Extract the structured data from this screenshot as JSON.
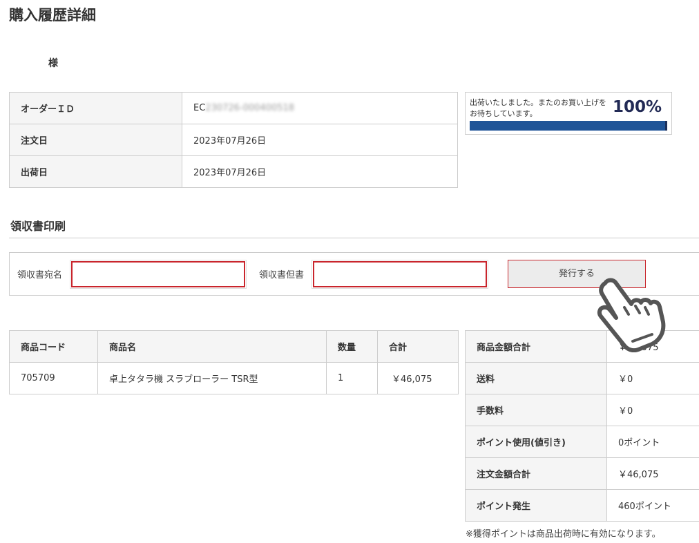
{
  "page_title": "購入履歴詳細",
  "customer_name": "様",
  "order": {
    "rows": [
      {
        "label": "オーダーＩＤ",
        "prefix": "EC",
        "value": "230726-000400518"
      },
      {
        "label": "注文日",
        "value": "2023年07月26日"
      },
      {
        "label": "出荷日",
        "value": "2023年07月26日"
      }
    ]
  },
  "status": {
    "message": "出荷いたしました。またのお買い上げをお待ちしています。",
    "percent_label": "100%",
    "progress": 1.0
  },
  "receipt": {
    "section_title": "領収書印刷",
    "addressee_label": "領収書宛名",
    "addressee_value": "",
    "proviso_label": "領収書但書",
    "proviso_value": "",
    "issue_button": "発行する"
  },
  "items": {
    "headers": [
      "商品コード",
      "商品名",
      "数量",
      "合計"
    ],
    "rows": [
      {
        "code": "705709",
        "name": "卓上タタラ機 スラブローラー TSR型",
        "qty": "1",
        "total": "￥46,075"
      }
    ]
  },
  "totals": [
    {
      "label": "商品金額合計",
      "value": "￥46,075"
    },
    {
      "label": "送料",
      "value": "￥0"
    },
    {
      "label": "手数料",
      "value": "￥0"
    },
    {
      "label": "ポイント使用(値引き)",
      "value": "0ポイント"
    },
    {
      "label": "注文金額合計",
      "value": "￥46,075"
    },
    {
      "label": "ポイント発生",
      "value": "460ポイント"
    }
  ],
  "points_note": "※獲得ポイントは商品出荷時に有効になります。",
  "colors": {
    "progress_fill": "#1f5497",
    "input_border": "#c9252c",
    "label_bg": "#f5f5f5"
  }
}
